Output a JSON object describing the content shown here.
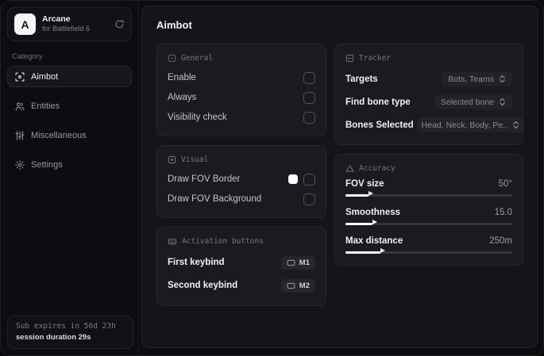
{
  "brand": {
    "logo_letter": "A",
    "name": "Arcane",
    "subtitle": "for Battlefield 6",
    "action_icon": "refresh-icon"
  },
  "sidebar": {
    "category_label": "Category",
    "items": [
      {
        "label": "Aimbot",
        "icon": "crosshair-icon",
        "active": true
      },
      {
        "label": "Entities",
        "icon": "users-icon",
        "active": false
      },
      {
        "label": "Miscellaneous",
        "icon": "sliders-icon",
        "active": false
      },
      {
        "label": "Settings",
        "icon": "gear-icon",
        "active": false
      }
    ],
    "footer": {
      "sub_expires": "Sub expires in 56d 23h",
      "session_duration": "session duration 29s"
    }
  },
  "main": {
    "title": "Aimbot"
  },
  "general": {
    "title": "General",
    "icon": "focus-square-icon",
    "rows": [
      {
        "label": "Enable",
        "checked": false
      },
      {
        "label": "Always",
        "checked": false
      },
      {
        "label": "Visibility check",
        "checked": false
      }
    ]
  },
  "visual": {
    "title": "Visual",
    "icon": "frame-icon",
    "rows": [
      {
        "label": "Draw FOV Border",
        "swatch_color": "#ffffff",
        "checked": false
      },
      {
        "label": "Draw FOV Background",
        "checked": false
      }
    ]
  },
  "activation": {
    "title": "Activation buttons",
    "icon": "keyboard-icon",
    "rows": [
      {
        "label": "First keybind",
        "key": "M1"
      },
      {
        "label": "Second keybind",
        "key": "M2"
      }
    ]
  },
  "tracker": {
    "title": "Tracker",
    "icon": "box-minus-icon",
    "rows": [
      {
        "label": "Targets",
        "value": "Bots, Teams"
      },
      {
        "label": "Find bone type",
        "value": "Selected bone"
      },
      {
        "label": "Bones Selected",
        "value": "Head, Neck, Body, Pe.."
      }
    ]
  },
  "accuracy": {
    "title": "Accuracy",
    "icon": "triangle-icon",
    "rows": [
      {
        "label": "FOV size",
        "value": "50°",
        "percent": 14
      },
      {
        "label": "Smoothness",
        "value": "15.0",
        "percent": 16
      },
      {
        "label": "Max distance",
        "value": "250m",
        "percent": 21
      }
    ]
  },
  "colors": {
    "accent": "#ffffff",
    "panel": "#141519",
    "card": "#1a1b20"
  }
}
